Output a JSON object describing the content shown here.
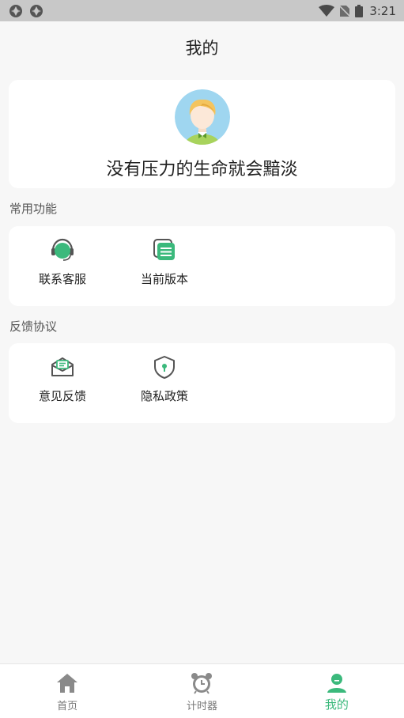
{
  "status_bar": {
    "time": "3:21"
  },
  "header": {
    "title": "我的"
  },
  "profile": {
    "motto": "没有压力的生命就会黯淡"
  },
  "sections": {
    "common": {
      "label": "常用功能",
      "items": [
        {
          "label": "联系客服",
          "icon": "headset-icon"
        },
        {
          "label": "当前版本",
          "icon": "version-icon"
        }
      ]
    },
    "feedback": {
      "label": "反馈协议",
      "items": [
        {
          "label": "意见反馈",
          "icon": "mail-feedback-icon"
        },
        {
          "label": "隐私政策",
          "icon": "shield-icon"
        }
      ]
    }
  },
  "tabs": [
    {
      "label": "首页",
      "icon": "home-icon"
    },
    {
      "label": "计时器",
      "icon": "alarm-clock-icon"
    },
    {
      "label": "我的",
      "icon": "user-icon",
      "active": true
    }
  ],
  "colors": {
    "accent": "#3bb97c",
    "icon_gray": "#8a8a8a",
    "background": "#f7f7f7"
  }
}
